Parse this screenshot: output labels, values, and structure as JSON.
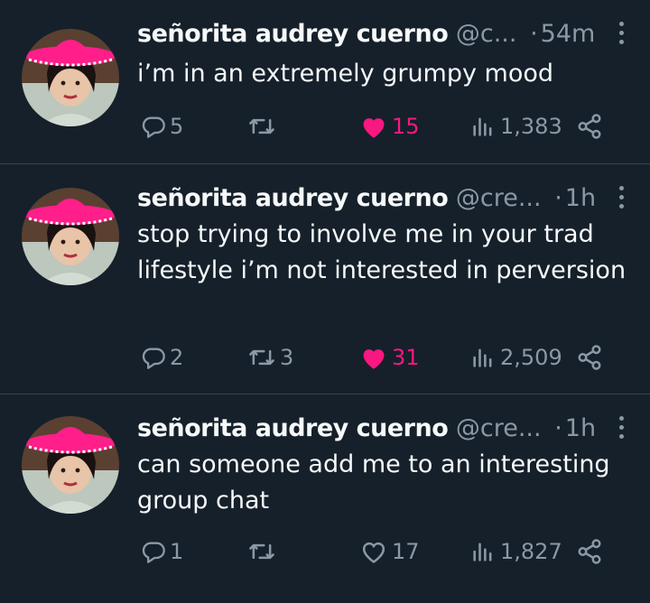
{
  "tweets": [
    {
      "name": "señorita audrey cuerno",
      "handle": "@c...",
      "time": "54m",
      "text": "i’m in an extremely grumpy mood",
      "replies": "5",
      "retweets": "",
      "likes": "15",
      "liked": true,
      "views": "1,383"
    },
    {
      "name": "señorita audrey cuerno",
      "handle": "@cre...",
      "time": "1h",
      "text": "stop trying to involve me in your trad lifestyle i’m not interested in perversion",
      "replies": "2",
      "retweets": "3",
      "likes": "31",
      "liked": true,
      "views": "2,509"
    },
    {
      "name": "señorita audrey cuerno",
      "handle": "@cre...",
      "time": "1h",
      "text": "can someone add me to an interesting group chat",
      "replies": "1",
      "retweets": "",
      "likes": "17",
      "liked": false,
      "views": "1,827"
    }
  ],
  "colors": {
    "background": "#15202b",
    "muted": "#8b98a5",
    "like_active": "#f91880",
    "divider": "#38444d"
  },
  "icons": [
    "reply-icon",
    "retweet-icon",
    "heart-icon",
    "views-icon",
    "share-icon",
    "more-icon"
  ]
}
